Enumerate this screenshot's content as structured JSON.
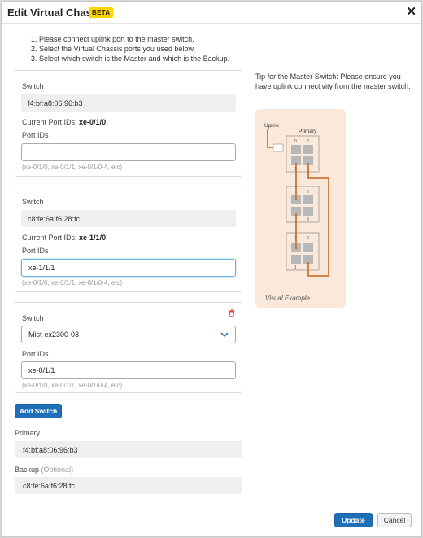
{
  "dialog": {
    "title": "Edit Virtual Chassis",
    "badge": "BETA",
    "close_glyph": "✕"
  },
  "instructions": [
    "1. Please connect uplink port to the master switch.",
    "2. Select the Virtual Chassis ports you used below.",
    "3. Select which switch is the Master and which is the Backup."
  ],
  "switches": [
    {
      "switch_label": "Switch",
      "switch_value": "f4:bf:a8:06:96:b3",
      "current_label": "Current Port IDs:",
      "current_value": "xe-0/1/0",
      "port_label": "Port IDs",
      "port_value": "",
      "hint": "(xe-0/1/0, xe-0/1/1, xe-0/1/0-4, etc)"
    },
    {
      "switch_label": "Switch",
      "switch_value": "c8:fe:6a:f6:28:fc",
      "current_label": "Current Port IDs:",
      "current_value": "xe-1/1/0",
      "port_label": "Port IDs",
      "port_value": "xe-1/1/1",
      "hint": "(xe-0/1/0, xe-0/1/1, xe-0/1/0-4, etc)"
    },
    {
      "switch_label": "Switch",
      "switch_value": "Mist-ex2300-03",
      "port_label": "Port IDs",
      "port_value": "xe-0/1/1",
      "hint": "(xe-0/1/0, xe-0/1/1, xe-0/1/0-4, etc)"
    }
  ],
  "add_switch_label": "Add Switch",
  "primary": {
    "label": "Primary",
    "value": "f4:bf:a8:06:96:b3"
  },
  "backup": {
    "label": "Backup",
    "optional": "(Optional)",
    "value": "c8:fe:6a:f6:28:fc"
  },
  "tip": "Tip for the Master Switch: Please ensure you have uplink connectivity from the master switch.",
  "visual": {
    "uplink_label": "Uplink",
    "primary_label": "Primary",
    "caption": "Visual Example",
    "unit_numbers": [
      "0",
      "2",
      "1",
      "2",
      "3",
      "1",
      "2",
      "1"
    ]
  },
  "footer": {
    "update_label": "Update",
    "cancel_label": "Cancel"
  },
  "colors": {
    "accent": "#1e6fb8",
    "beta": "#ffd400",
    "diagram_bg": "#fae8da",
    "cable": "#c8651b",
    "delete": "#e24b4b"
  },
  "icons": {
    "close": "close-icon",
    "delete": "trash-icon",
    "dropdown": "chevron-down-icon"
  }
}
